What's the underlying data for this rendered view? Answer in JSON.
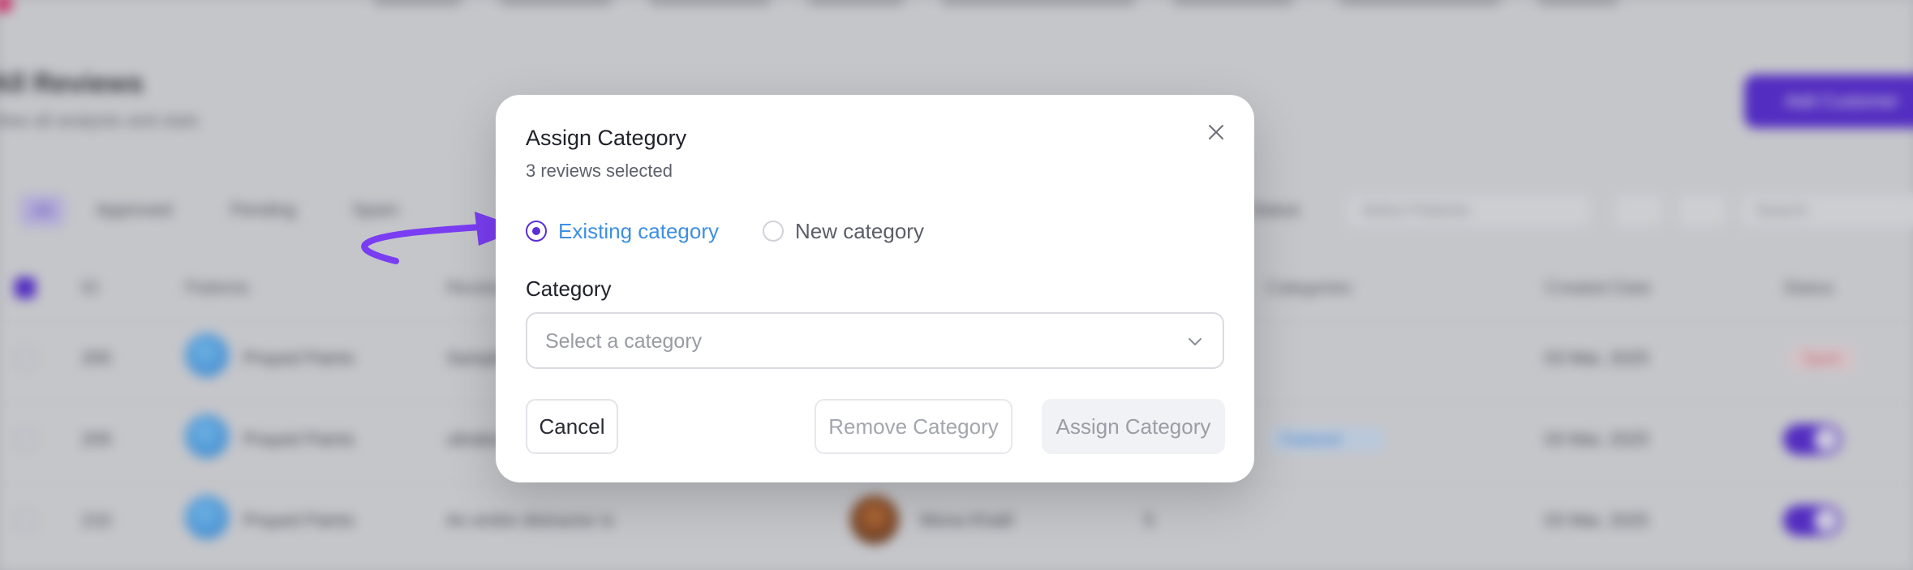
{
  "background": {
    "page_title": "All Reviews",
    "page_subtitle": "View all analysts and stats",
    "add_button": "Add Customer",
    "filter_tabs": [
      "All",
      "Approved",
      "Pending",
      "Spam"
    ],
    "filter_label": "Status",
    "filter_select_placeholder": "Select Patients",
    "search_placeholder": "Search",
    "columns": [
      "ID",
      "Patients",
      "Review",
      "Categories",
      "Created Date",
      "Status"
    ],
    "rows": [
      {
        "id": "200",
        "patient": "Prayed Paints",
        "review": "Sample review",
        "date": "03 Mar, 2025",
        "status": "Spam"
      },
      {
        "id": "209",
        "patient": "Prayed Paints",
        "review": "ultrabook",
        "category": "Featured",
        "date": "03 Mar, 2025"
      },
      {
        "id": "210",
        "patient": "Prayed Paints",
        "review": "An entire distractor is",
        "reviewer": "Mona Khalil",
        "score": "5",
        "date": "03 Mar, 2025"
      }
    ]
  },
  "modal": {
    "title": "Assign Category",
    "subtitle": "3 reviews selected",
    "radio_options": [
      {
        "label": "Existing category",
        "checked": true
      },
      {
        "label": "New category",
        "checked": false
      }
    ],
    "field_label": "Category",
    "select_placeholder": "Select a category",
    "buttons": {
      "cancel": "Cancel",
      "remove": "Remove Category",
      "assign": "Assign Category"
    }
  },
  "colors": {
    "accent": "#5a2fd6",
    "arrow": "#7a3df2",
    "active_option_text": "#3d8fe3"
  },
  "icons": [
    "close-icon",
    "chevron-down-icon",
    "annotation-arrow"
  ]
}
